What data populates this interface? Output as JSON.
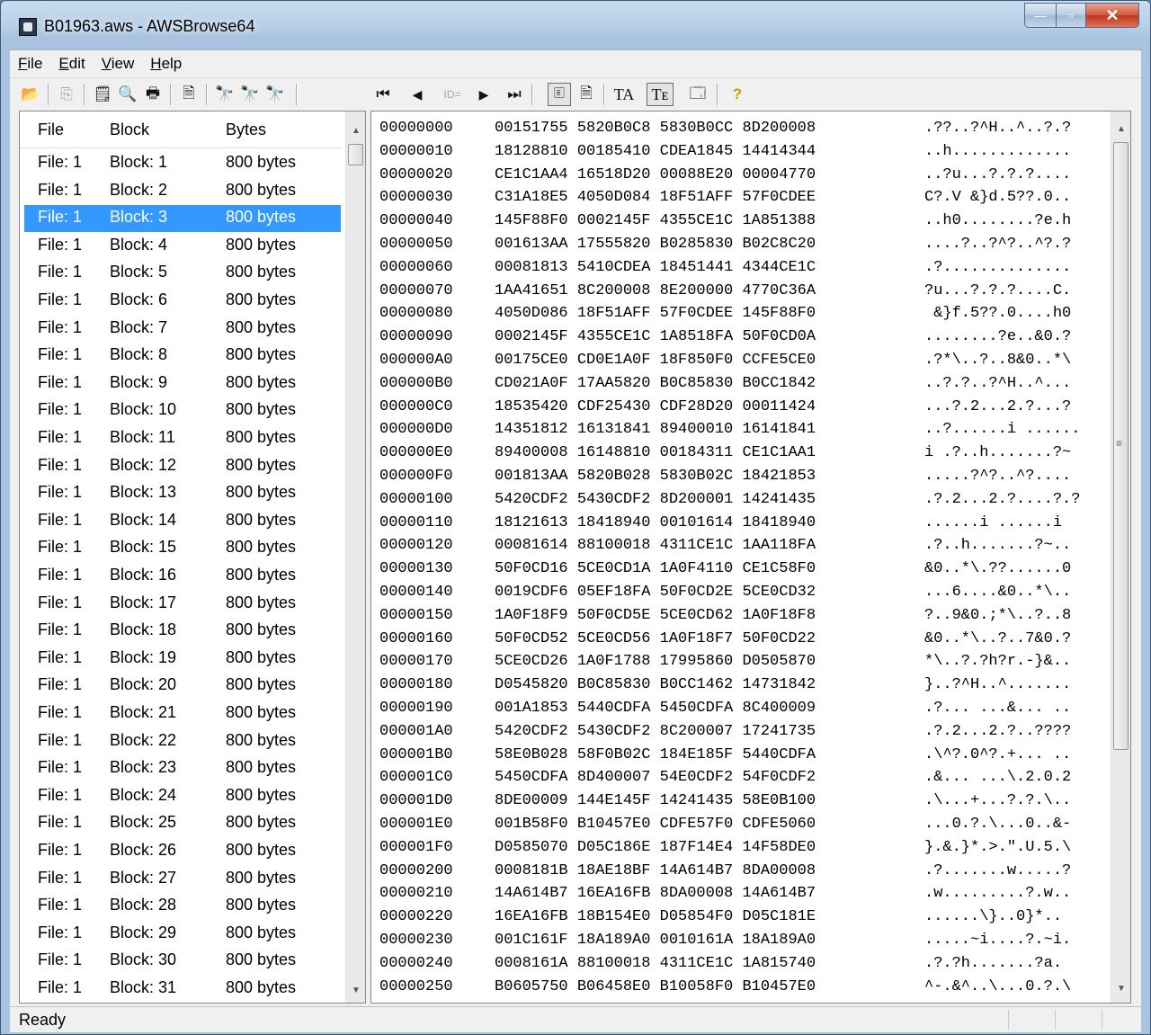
{
  "window": {
    "title": "B01963.aws - AWSBrowse64"
  },
  "menu": [
    {
      "first": "F",
      "rest": "ile"
    },
    {
      "first": "E",
      "rest": "dit"
    },
    {
      "first": "V",
      "rest": "iew"
    },
    {
      "first": "H",
      "rest": "elp"
    }
  ],
  "caption": {
    "minimize": "—",
    "maximize": "▫",
    "close": "✕"
  },
  "toolbar_icons": {
    "open": "📂",
    "copy": "⎘",
    "properties": "🗒",
    "print_preview": "🔍",
    "print": "🖶",
    "export": "🗎",
    "find": "🔭",
    "find_next": "🔭",
    "find_prev": "🔭",
    "first": "⏮",
    "prev": "◀",
    "id": "ID=",
    "next": "▶",
    "last": "⏭",
    "hex_view": "🗉",
    "text_view": "🗎",
    "font_a": "TA",
    "font_b": "Tᴇ",
    "options": "🗔",
    "help": "?"
  },
  "file_list": {
    "headers": {
      "file": "File",
      "block": "Block",
      "bytes": "Bytes"
    },
    "rows": [
      {
        "file": "File: 1",
        "block": "Block: 1",
        "bytes": "800 bytes"
      },
      {
        "file": "File: 1",
        "block": "Block: 2",
        "bytes": "800 bytes"
      },
      {
        "file": "File: 1",
        "block": "Block: 3",
        "bytes": "800 bytes",
        "selected": true
      },
      {
        "file": "File: 1",
        "block": "Block: 4",
        "bytes": "800 bytes"
      },
      {
        "file": "File: 1",
        "block": "Block: 5",
        "bytes": "800 bytes"
      },
      {
        "file": "File: 1",
        "block": "Block: 6",
        "bytes": "800 bytes"
      },
      {
        "file": "File: 1",
        "block": "Block: 7",
        "bytes": "800 bytes"
      },
      {
        "file": "File: 1",
        "block": "Block: 8",
        "bytes": "800 bytes"
      },
      {
        "file": "File: 1",
        "block": "Block: 9",
        "bytes": "800 bytes"
      },
      {
        "file": "File: 1",
        "block": "Block: 10",
        "bytes": "800 bytes"
      },
      {
        "file": "File: 1",
        "block": "Block: 11",
        "bytes": "800 bytes"
      },
      {
        "file": "File: 1",
        "block": "Block: 12",
        "bytes": "800 bytes"
      },
      {
        "file": "File: 1",
        "block": "Block: 13",
        "bytes": "800 bytes"
      },
      {
        "file": "File: 1",
        "block": "Block: 14",
        "bytes": "800 bytes"
      },
      {
        "file": "File: 1",
        "block": "Block: 15",
        "bytes": "800 bytes"
      },
      {
        "file": "File: 1",
        "block": "Block: 16",
        "bytes": "800 bytes"
      },
      {
        "file": "File: 1",
        "block": "Block: 17",
        "bytes": "800 bytes"
      },
      {
        "file": "File: 1",
        "block": "Block: 18",
        "bytes": "800 bytes"
      },
      {
        "file": "File: 1",
        "block": "Block: 19",
        "bytes": "800 bytes"
      },
      {
        "file": "File: 1",
        "block": "Block: 20",
        "bytes": "800 bytes"
      },
      {
        "file": "File: 1",
        "block": "Block: 21",
        "bytes": "800 bytes"
      },
      {
        "file": "File: 1",
        "block": "Block: 22",
        "bytes": "800 bytes"
      },
      {
        "file": "File: 1",
        "block": "Block: 23",
        "bytes": "800 bytes"
      },
      {
        "file": "File: 1",
        "block": "Block: 24",
        "bytes": "800 bytes"
      },
      {
        "file": "File: 1",
        "block": "Block: 25",
        "bytes": "800 bytes"
      },
      {
        "file": "File: 1",
        "block": "Block: 26",
        "bytes": "800 bytes"
      },
      {
        "file": "File: 1",
        "block": "Block: 27",
        "bytes": "800 bytes"
      },
      {
        "file": "File: 1",
        "block": "Block: 28",
        "bytes": "800 bytes"
      },
      {
        "file": "File: 1",
        "block": "Block: 29",
        "bytes": "800 bytes"
      },
      {
        "file": "File: 1",
        "block": "Block: 30",
        "bytes": "800 bytes"
      },
      {
        "file": "File: 1",
        "block": "Block: 31",
        "bytes": "800 bytes"
      }
    ]
  },
  "hex_rows": [
    {
      "offset": "00000000",
      "words": "00151755 5820B0C8 5830B0CC 8D200008",
      "ascii": ".??..?^H..^..?.?"
    },
    {
      "offset": "00000010",
      "words": "18128810 00185410 CDEA1845 14414344",
      "ascii": "..h............."
    },
    {
      "offset": "00000020",
      "words": "CE1C1AA4 16518D20 00088E20 00004770",
      "ascii": "..?u...?.?.?...."
    },
    {
      "offset": "00000030",
      "words": "C31A18E5 4050D084 18F51AFF 57F0CDEE",
      "ascii": "C?.V &}d.5??.0.."
    },
    {
      "offset": "00000040",
      "words": "145F88F0 0002145F 4355CE1C 1A851388",
      "ascii": "..h0........?e.h"
    },
    {
      "offset": "00000050",
      "words": "001613AA 17555820 B0285830 B02C8C20",
      "ascii": "....?..?^?..^?.?"
    },
    {
      "offset": "00000060",
      "words": "00081813 5410CDEA 18451441 4344CE1C",
      "ascii": ".?.............."
    },
    {
      "offset": "00000070",
      "words": "1AA41651 8C200008 8E200000 4770C36A",
      "ascii": "?u...?.?.?....C."
    },
    {
      "offset": "00000080",
      "words": "4050D086 18F51AFF 57F0CDEE 145F88F0",
      "ascii": " &}f.5??.0....h0"
    },
    {
      "offset": "00000090",
      "words": "0002145F 4355CE1C 1A8518FA 50F0CD0A",
      "ascii": "........?e..&0.?"
    },
    {
      "offset": "000000A0",
      "words": "00175CE0 CD0E1A0F 18F850F0 CCFE5CE0",
      "ascii": ".?*\\..?..8&0..*\\"
    },
    {
      "offset": "000000B0",
      "words": "CD021A0F 17AA5820 B0C85830 B0CC1842",
      "ascii": "..?.?..?^H..^..."
    },
    {
      "offset": "000000C0",
      "words": "18535420 CDF25430 CDF28D20 00011424",
      "ascii": "...?.2...2.?...?"
    },
    {
      "offset": "000000D0",
      "words": "14351812 16131841 89400010 16141841",
      "ascii": "..?......i ......"
    },
    {
      "offset": "000000E0",
      "words": "89400008 16148810 00184311 CE1C1AA1",
      "ascii": "i .?..h.......?~"
    },
    {
      "offset": "000000F0",
      "words": "001813AA 5820B028 5830B02C 18421853",
      "ascii": ".....?^?..^?...."
    },
    {
      "offset": "00000100",
      "words": "5420CDF2 5430CDF2 8D200001 14241435",
      "ascii": ".?.2...2.?....?.?"
    },
    {
      "offset": "00000110",
      "words": "18121613 18418940 00101614 18418940",
      "ascii": "......i ......i"
    },
    {
      "offset": "00000120",
      "words": "00081614 88100018 4311CE1C 1AA118FA",
      "ascii": ".?..h.......?~.."
    },
    {
      "offset": "00000130",
      "words": "50F0CD16 5CE0CD1A 1A0F4110 CE1C58F0",
      "ascii": "&0..*\\.??......0"
    },
    {
      "offset": "00000140",
      "words": "0019CDF6 05EF18FA 50F0CD2E 5CE0CD32",
      "ascii": "...6....&0..*\\.."
    },
    {
      "offset": "00000150",
      "words": "1A0F18F9 50F0CD5E 5CE0CD62 1A0F18F8",
      "ascii": "?..9&0.;*\\..?..8"
    },
    {
      "offset": "00000160",
      "words": "50F0CD52 5CE0CD56 1A0F18F7 50F0CD22",
      "ascii": "&0..*\\..?..7&0.?"
    },
    {
      "offset": "00000170",
      "words": "5CE0CD26 1A0F1788 17995860 D0505870",
      "ascii": "*\\..?.?h?r.-}&.."
    },
    {
      "offset": "00000180",
      "words": "D0545820 B0C85830 B0CC1462 14731842",
      "ascii": "}..?^H..^......."
    },
    {
      "offset": "00000190",
      "words": "001A1853 5440CDFA 5450CDFA 8C400009",
      "ascii": ".?... ...&... .."
    },
    {
      "offset": "000001A0",
      "words": "5420CDF2 5430CDF2 8C200007 17241735",
      "ascii": ".?.2...2.?..????"
    },
    {
      "offset": "000001B0",
      "words": "58E0B028 58F0B02C 184E185F 5440CDFA",
      "ascii": ".\\^?.0^?.+... .."
    },
    {
      "offset": "000001C0",
      "words": "5450CDFA 8D400007 54E0CDF2 54F0CDF2",
      "ascii": ".&... ...\\.2.0.2"
    },
    {
      "offset": "000001D0",
      "words": "8DE00009 144E145F 14241435 58E0B100",
      "ascii": ".\\...+...?.?.\\.."
    },
    {
      "offset": "000001E0",
      "words": "001B58F0 B10457E0 CDFE57F0 CDFE5060",
      "ascii": "...0.?.\\...0..&-"
    },
    {
      "offset": "000001F0",
      "words": "D0585070 D05C186E 187F14E4 14F58DE0",
      "ascii": "}.&.}*.>.\".U.5.\\"
    },
    {
      "offset": "00000200",
      "words": "0008181B 18AE18BF 14A614B7 8DA00008",
      "ascii": ".?.......w.....?"
    },
    {
      "offset": "00000210",
      "words": "14A614B7 16EA16FB 8DA00008 14A614B7",
      "ascii": ".w.........?.w.."
    },
    {
      "offset": "00000220",
      "words": "16EA16FB 18B154E0 D05854F0 D05C181E",
      "ascii": "......\\}..0}*.."
    },
    {
      "offset": "00000230",
      "words": "001C161F 18A189A0 0010161A 18A189A0",
      "ascii": ".....~i....?.~i."
    },
    {
      "offset": "00000240",
      "words": "0008161A 88100018 4311CE1C 1A815740",
      "ascii": ".?.?h.......?a."
    },
    {
      "offset": "00000250",
      "words": "B0605750 B06458E0 B10058F0 B10457E0",
      "ascii": "^-.&^..\\...0.?.\\"
    }
  ],
  "status": {
    "text": "Ready"
  }
}
